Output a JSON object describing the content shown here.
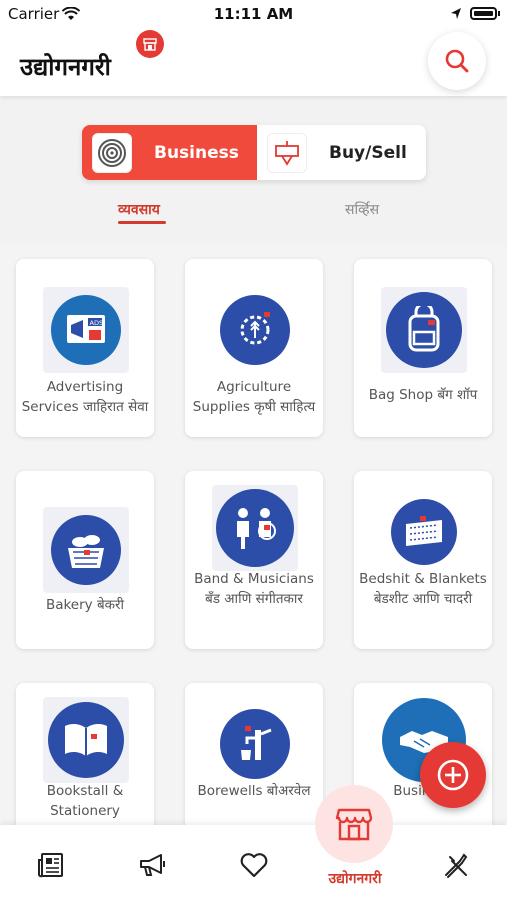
{
  "status": {
    "carrier": "Carrier",
    "time": "11:11 AM"
  },
  "header": {
    "app_title": "उद्योगनगरी"
  },
  "segment": {
    "business_label": "Business",
    "buysell_label": "Buy/Sell"
  },
  "tabs": {
    "active": "व्यवसाय",
    "inactive": "सर्व्हिस"
  },
  "categories": [
    {
      "label": "Advertising Services जाहिरात सेवा",
      "icon": "advertising-icon"
    },
    {
      "label": "Agriculture Supplies कृषी साहित्य",
      "icon": "agriculture-icon"
    },
    {
      "label": "Bag Shop बॅग शॉप",
      "icon": "bag-icon"
    },
    {
      "label": "Bakery बेकरी",
      "icon": "bakery-basket-icon"
    },
    {
      "label": "Band & Musicians बँड आणि संगीतकार",
      "icon": "band-musicians-icon"
    },
    {
      "label": "Bedshit & Blankets बेडशीट आणि चादरी",
      "icon": "blanket-icon"
    },
    {
      "label": "Bookstall & Stationery",
      "icon": "book-icon"
    },
    {
      "label": "Borewells बोअरवेल",
      "icon": "hand-pump-icon"
    },
    {
      "label": "Business",
      "icon": "handshake-icon"
    }
  ],
  "bottom_nav": {
    "items": [
      "news-icon",
      "megaphone-icon",
      "heart-icon",
      "store-icon",
      "tools-icon"
    ],
    "center_label": "उद्योगनगरी"
  },
  "colors": {
    "accent": "#e53935",
    "brand_blue": "#2c4ea8",
    "tab_active": "#d23b2e"
  }
}
